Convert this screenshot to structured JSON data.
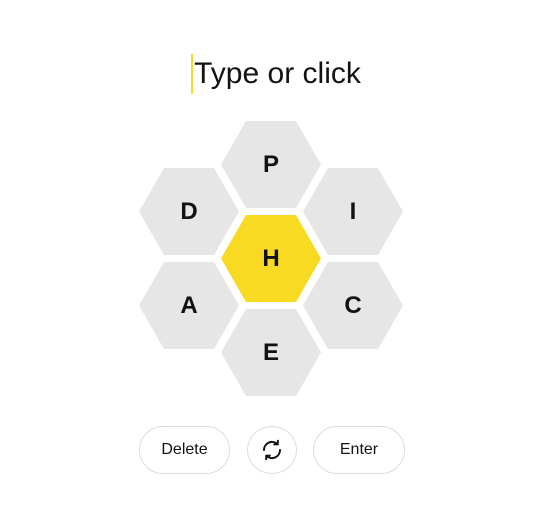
{
  "input": {
    "placeholder": "Type or click"
  },
  "hive": {
    "center_letter": "H",
    "outer_letters": {
      "top": "P",
      "upper_left": "D",
      "upper_right": "I",
      "lower_left": "A",
      "lower_right": "C",
      "bottom": "E"
    }
  },
  "controls": {
    "delete_label": "Delete",
    "shuffle_icon": "shuffle-icon",
    "enter_label": "Enter"
  },
  "colors": {
    "center_cell": "#f7da21",
    "outer_cell": "#e6e6e6",
    "caret": "#f7da21",
    "text": "#121212"
  }
}
